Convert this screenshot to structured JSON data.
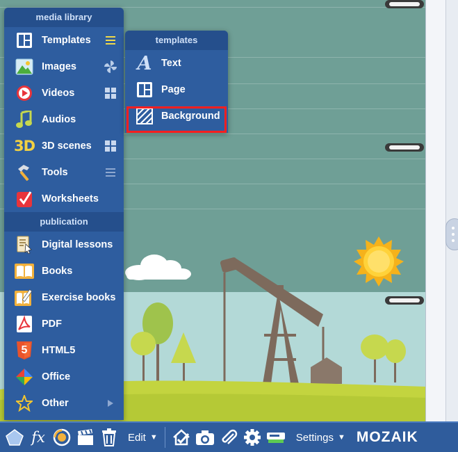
{
  "main_menu": {
    "header": "media library",
    "items": [
      {
        "label": "Templates",
        "icon": "templates-icon"
      },
      {
        "label": "Images",
        "icon": "images-icon"
      },
      {
        "label": "Videos",
        "icon": "videos-icon"
      },
      {
        "label": "Audios",
        "icon": "audios-icon"
      },
      {
        "label": "3D scenes",
        "icon": "3d-scenes-icon",
        "icon_text": "3D"
      },
      {
        "label": "Tools",
        "icon": "tools-icon"
      },
      {
        "label": "Worksheets",
        "icon": "worksheets-icon"
      }
    ],
    "publication_header": "publication",
    "publication_items": [
      {
        "label": "Digital lessons",
        "icon": "digital-lessons-icon"
      },
      {
        "label": "Books",
        "icon": "books-icon"
      },
      {
        "label": "Exercise books",
        "icon": "exercise-books-icon"
      },
      {
        "label": "PDF",
        "icon": "pdf-icon"
      },
      {
        "label": "HTML5",
        "icon": "html5-icon",
        "icon_text": "5"
      },
      {
        "label": "Office",
        "icon": "office-icon"
      },
      {
        "label": "Other",
        "icon": "other-icon"
      }
    ]
  },
  "templates_menu": {
    "header": "templates",
    "items": [
      {
        "label": "Text",
        "icon": "text-template-icon",
        "icon_text": "A"
      },
      {
        "label": "Page",
        "icon": "page-template-icon"
      },
      {
        "label": "Background",
        "icon": "background-template-icon",
        "highlighted": true
      }
    ]
  },
  "toolbar": {
    "edit_label": "Edit",
    "settings_label": "Settings",
    "logo_text": "MOZAIK",
    "fx_label": "fx"
  },
  "colors": {
    "menu_bg": "#2e5d9f",
    "menu_header_bg": "#254f8c",
    "canvas_bg": "#6f9f96",
    "highlight": "#ff1f1f",
    "toolbar_bg": "#2f5c9c"
  }
}
